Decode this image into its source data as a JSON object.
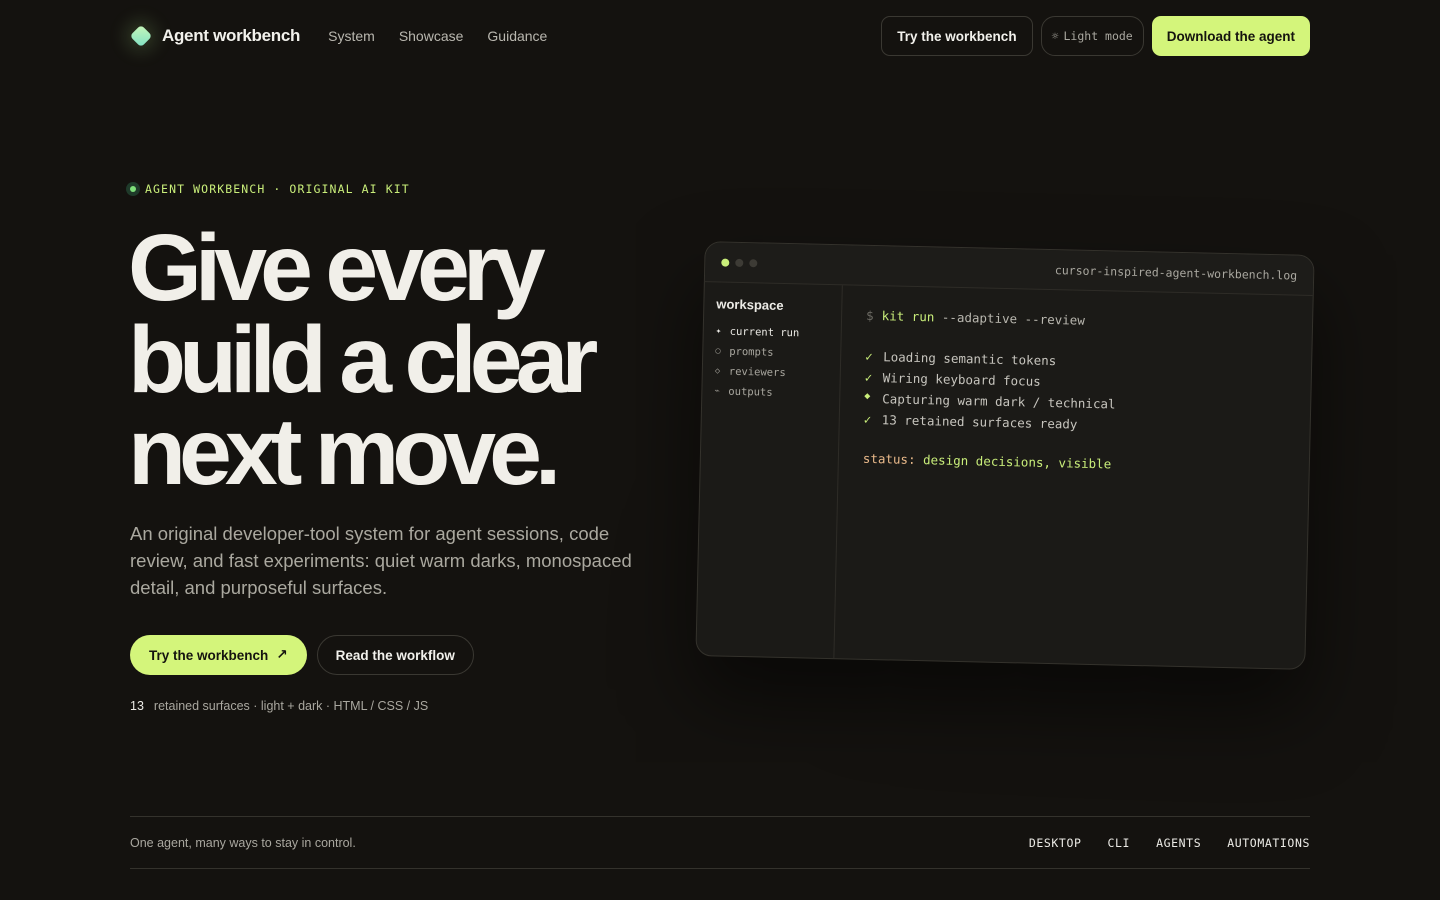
{
  "nav": {
    "brand": "Agent workbench",
    "links": [
      "System",
      "Showcase",
      "Guidance"
    ],
    "try_label": "Try the workbench",
    "theme_label": "Light mode",
    "download_label": "Download the agent"
  },
  "hero": {
    "eyebrow": "AGENT WORKBENCH · ORIGINAL AI KIT",
    "headline": [
      "Give every",
      "build a clear",
      "next move."
    ],
    "lede": "An original developer-tool system for agent sessions, code review, and fast experiments: quiet warm darks, monospaced detail, and purposeful surfaces.",
    "primary_cta": "Try the workbench",
    "secondary_cta": "Read the workflow",
    "meta_count": "13",
    "meta_text": "retained surfaces · light + dark · HTML / CSS / JS"
  },
  "terminal": {
    "filename": "cursor-inspired-agent-workbench.log",
    "sidebar_title": "workspace",
    "sidebar_items": [
      {
        "glyph": "✦",
        "label": "current run"
      },
      {
        "glyph": "○",
        "label": "prompts"
      },
      {
        "glyph": "◇",
        "label": "reviewers"
      },
      {
        "glyph": "⌁",
        "label": "outputs"
      }
    ],
    "prompt": "$",
    "command_kw": "kit run",
    "command_args": "--adaptive --review",
    "lines": [
      {
        "mark": "✓",
        "text": "Loading semantic tokens"
      },
      {
        "mark": "✓",
        "text": "Wiring keyboard focus"
      },
      {
        "mark": "◆",
        "text": "Capturing warm dark / technical"
      },
      {
        "mark": "✓",
        "text": "13 retained surfaces ready"
      }
    ],
    "status_key": "status:",
    "status_value": "design decisions, visible"
  },
  "strip": {
    "text": "One agent, many ways to stay in control.",
    "tags": [
      "DESKTOP",
      "CLI",
      "AGENTS",
      "AUTOMATIONS"
    ]
  },
  "colors": {
    "background": "#14120f",
    "accent": "#d4f57b",
    "accent_text": "#c9ee7a"
  }
}
